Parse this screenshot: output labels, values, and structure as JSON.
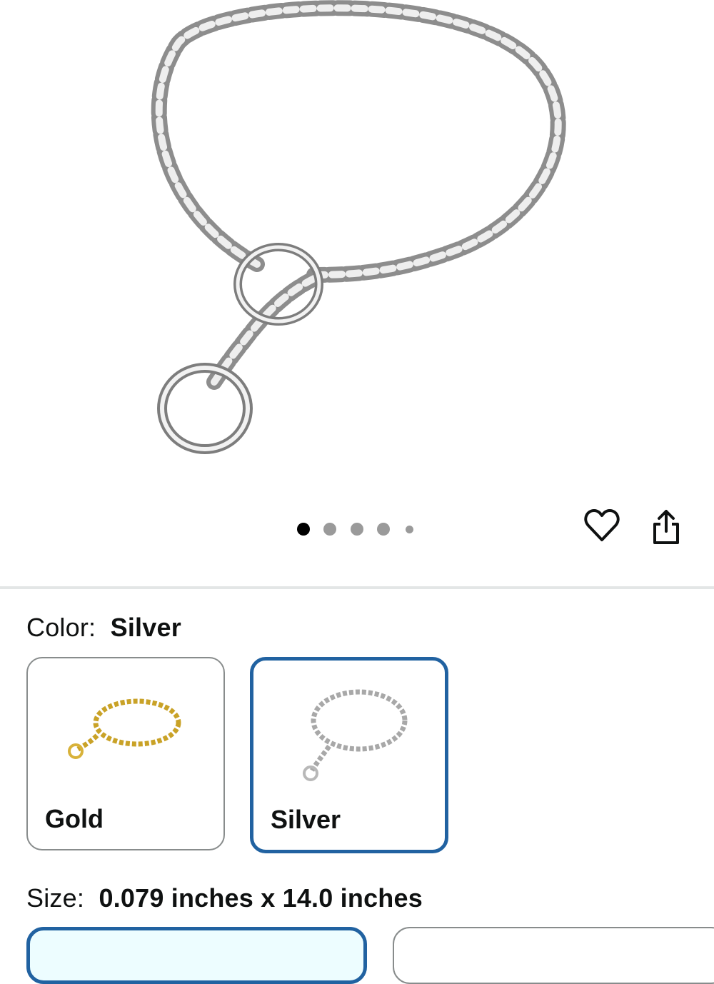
{
  "product": {
    "image_name": "silver-chain-collar-image",
    "image_count": 5,
    "active_image": 1
  },
  "actions": {
    "favorite_icon": "heart-icon",
    "share_icon": "share-icon"
  },
  "color": {
    "label": "Color:",
    "selected": "Silver",
    "options": [
      {
        "name": "Gold",
        "selected": false
      },
      {
        "name": "Silver",
        "selected": true
      }
    ]
  },
  "size": {
    "label": "Size:",
    "selected": "0.079 inches x 14.0 inches"
  },
  "colors": {
    "selection_border": "#2162a1",
    "selected_size_bg": "#edfdff",
    "unselected_border": "#888c8c"
  }
}
